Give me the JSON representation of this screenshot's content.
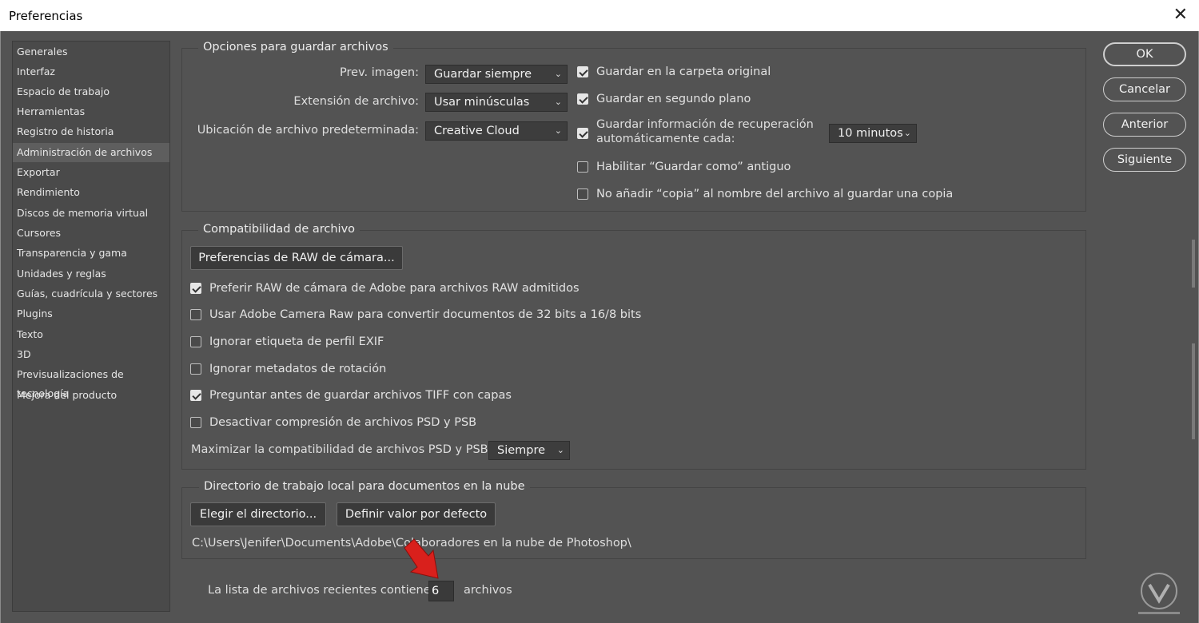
{
  "window": {
    "title": "Preferencias",
    "close_icon": "close-icon"
  },
  "sidebar": {
    "items": [
      {
        "label": "Generales"
      },
      {
        "label": "Interfaz"
      },
      {
        "label": "Espacio de trabajo"
      },
      {
        "label": "Herramientas"
      },
      {
        "label": "Registro de historia"
      },
      {
        "label": "Administración de archivos",
        "selected": true
      },
      {
        "label": "Exportar"
      },
      {
        "label": "Rendimiento"
      },
      {
        "label": "Discos de memoria virtual"
      },
      {
        "label": "Cursores"
      },
      {
        "label": "Transparencia y gama"
      },
      {
        "label": "Unidades y reglas"
      },
      {
        "label": "Guías, cuadrícula y sectores"
      },
      {
        "label": "Plugins"
      },
      {
        "label": "Texto"
      },
      {
        "label": "3D"
      },
      {
        "label": "Previsualizaciones de tecnología"
      },
      {
        "label": "Mejora del producto"
      }
    ]
  },
  "save_options": {
    "title": "Opciones para guardar archivos",
    "preview_label": "Prev. imagen:",
    "preview_value": "Guardar siempre",
    "extension_label": "Extensión de archivo:",
    "extension_value": "Usar minúsculas",
    "location_label": "Ubicación de archivo predeterminada:",
    "location_value": "Creative Cloud",
    "save_original_folder": {
      "label": "Guardar en la carpeta original",
      "checked": true
    },
    "save_background": {
      "label": "Guardar en segundo plano",
      "checked": true
    },
    "auto_recovery": {
      "label_line1": "Guardar información de recuperación",
      "label_line2": "automáticamente cada:",
      "checked": true
    },
    "auto_recovery_interval": "10 minutos",
    "legacy_save_as": {
      "label": "Habilitar “Guardar como” antiguo",
      "checked": false
    },
    "no_copy_suffix": {
      "label": "No añadir “copia” al nombre del archivo al guardar una copia",
      "checked": false
    }
  },
  "compatibility": {
    "title": "Compatibilidad de archivo",
    "camera_raw_button": "Preferencias de RAW de cámara...",
    "prefer_adobe_raw": {
      "label": "Preferir RAW de cámara de Adobe para archivos RAW admitidos",
      "checked": true
    },
    "use_acr_32bit": {
      "label": "Usar Adobe Camera Raw para convertir documentos de 32 bits a 16/8 bits",
      "checked": false
    },
    "ignore_exif": {
      "label": "Ignorar etiqueta de perfil EXIF",
      "checked": false
    },
    "ignore_rotation": {
      "label": "Ignorar metadatos de rotación",
      "checked": false
    },
    "ask_tiff_layers": {
      "label": "Preguntar antes de guardar archivos TIFF con capas",
      "checked": true
    },
    "disable_psd_compression": {
      "label": "Desactivar compresión de archivos PSD y PSB",
      "checked": false
    },
    "maximize_label": "Maximizar la compatibilidad de archivos PSD y PSB:",
    "maximize_value": "Siempre"
  },
  "cloud_dir": {
    "title": "Directorio de trabajo local para documentos en la nube",
    "choose_button": "Elegir el directorio...",
    "default_button": "Definir valor por defecto",
    "path": "C:\\Users\\Jenifer\\Documents\\Adobe\\Colaboradores en la nube de Photoshop\\"
  },
  "recent": {
    "label": "La lista de archivos recientes contiene:",
    "value": "6",
    "suffix": "archivos"
  },
  "buttons": {
    "ok": "OK",
    "cancel": "Cancelar",
    "previous": "Anterior",
    "next": "Siguiente"
  },
  "colors": {
    "background": "#535353",
    "sidebar": "#4a4a4a",
    "selected": "#5e5e5e",
    "arrow": "#d9201c"
  }
}
